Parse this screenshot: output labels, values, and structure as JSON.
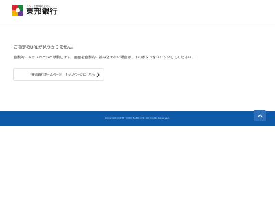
{
  "header": {
    "logo": {
      "tagline": "すべてを地域のために",
      "name": "東邦銀行",
      "colors": [
        "#d9262f",
        "#1d8a3a",
        "#f0b400",
        "#6a3b96"
      ]
    }
  },
  "main": {
    "message_title": "ご指定のURLが見つかりません。",
    "message_body": "自動的にトップページへ移動します。画面を自動的に読み込まない場合は、下のボタンをクリックしてください。",
    "top_link": {
      "label": "「東邦銀行ホームページ」トップページはこちら",
      "icon": "chevron-right-icon"
    }
  },
  "footer": {
    "copyright": "Copyright(C)THE TOHO BANK, LTD. All Rights Reserved.",
    "background": "#0f59a9",
    "pagetop_icon": "chevron-up-icon"
  }
}
